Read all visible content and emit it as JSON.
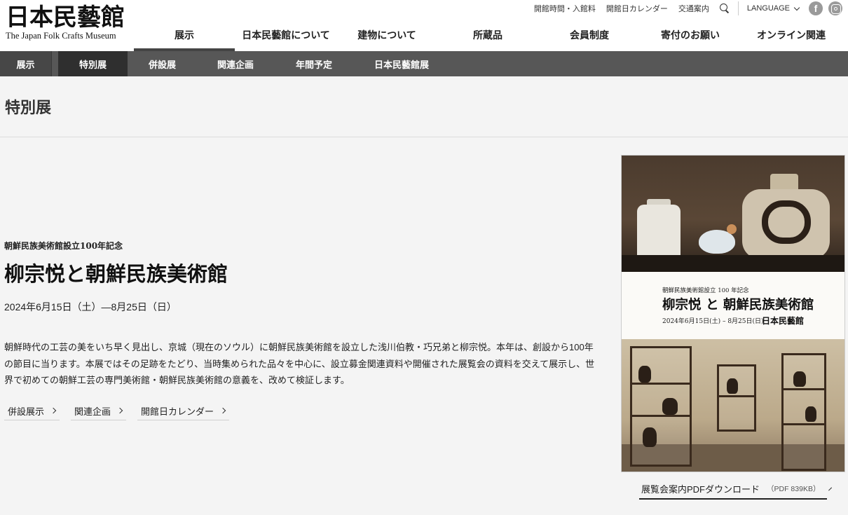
{
  "logo": {
    "jp": "日本民藝館",
    "en": "The Japan Folk Crafts Museum"
  },
  "util": {
    "links": [
      "開館時間・入館料",
      "開館日カレンダー",
      "交通案内"
    ],
    "language": "LANGUAGE",
    "facebook_glyph": "f"
  },
  "global_nav": [
    "展示",
    "日本民藝館について",
    "建物について",
    "所蔵品",
    "会員制度",
    "寄付のお願い",
    "オンライン関連"
  ],
  "sub_nav": {
    "root": "展示",
    "items": [
      "特別展",
      "併設展",
      "関連企画",
      "年間予定",
      "日本民藝館展"
    ]
  },
  "page_title": "特別展",
  "exhibition": {
    "kicker": "朝鮮民族美術館設立100年記念",
    "title": "柳宗悦と朝鮮民族美術館",
    "dates": "2024年6月15日（土）―8月25日（日）",
    "description": "朝鮮時代の工芸の美をいち早く見出し、京城（現在のソウル）に朝鮮民族美術館を設立した浅川伯教・巧兄弟と柳宗悦。本年は、創設から100年の節目に当ります。本展ではその足跡をたどり、当時集められた品々を中心に、設立募金関連資料や開催された展覧会の資料を交えて展示し、世界で初めての朝鮮工芸の専門美術館・朝鮮民族美術館の意義を、改めて検証します。",
    "links": [
      "併設展示",
      "関連企画",
      "開館日カレンダー"
    ]
  },
  "poster": {
    "kicker": "朝鮮民族美術館設立 100 年記念",
    "title": "柳宗悦 と 朝鮮民族美術館",
    "date": "2024年6月15日(土) – 8月25日(日)",
    "logo": "日本民藝館"
  },
  "pdf": {
    "label": "展覧会案内PDFダウンロード",
    "size": "（PDF 839KB）"
  }
}
